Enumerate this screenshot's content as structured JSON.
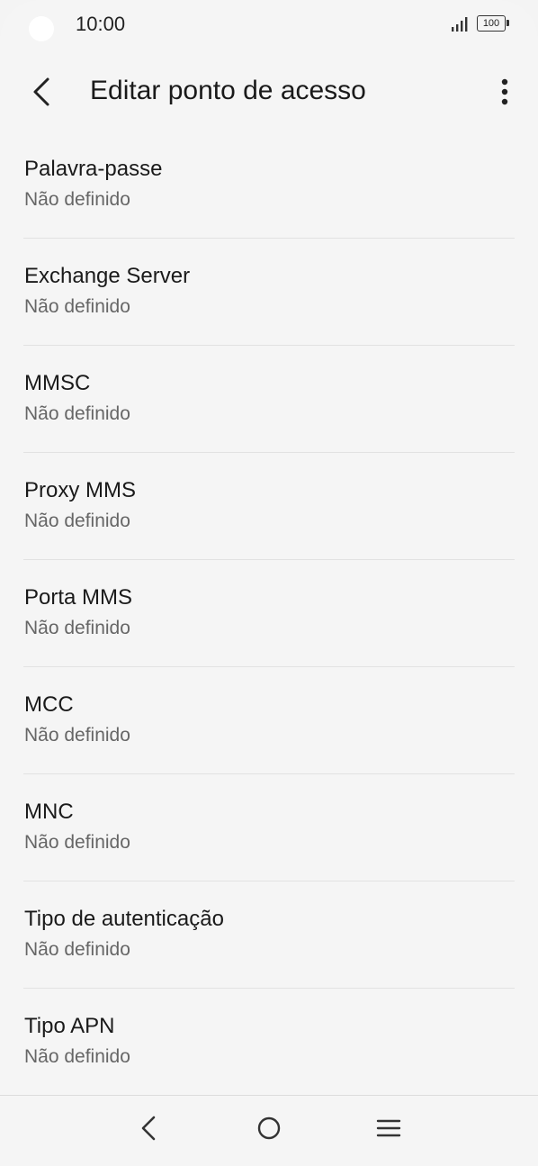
{
  "status_bar": {
    "time": "10:00",
    "battery_level": "100",
    "icons": [
      "camera-cutout",
      "signal-icon",
      "battery-icon"
    ]
  },
  "app_bar": {
    "title": "Editar ponto de acesso",
    "back_icon": "chevron-left-icon",
    "menu_icon": "more-vertical-icon"
  },
  "settings": [
    {
      "title": "Palavra-passe",
      "value": "Não definido"
    },
    {
      "title": "Exchange Server",
      "value": "Não definido"
    },
    {
      "title": "MMSC",
      "value": "Não definido"
    },
    {
      "title": "Proxy MMS",
      "value": "Não definido"
    },
    {
      "title": "Porta MMS",
      "value": "Não definido"
    },
    {
      "title": "MCC",
      "value": "Não definido"
    },
    {
      "title": "MNC",
      "value": "Não definido"
    },
    {
      "title": "Tipo de autenticação",
      "value": "Não definido"
    },
    {
      "title": "Tipo APN",
      "value": "Não definido"
    }
  ],
  "nav_bar": {
    "icons": [
      "nav-back-icon",
      "nav-home-icon",
      "nav-recents-icon"
    ]
  },
  "colors": {
    "background": "#f5f5f5",
    "text_primary": "#1a1a1a",
    "text_secondary": "#666666",
    "divider": "#e2e2e2"
  }
}
